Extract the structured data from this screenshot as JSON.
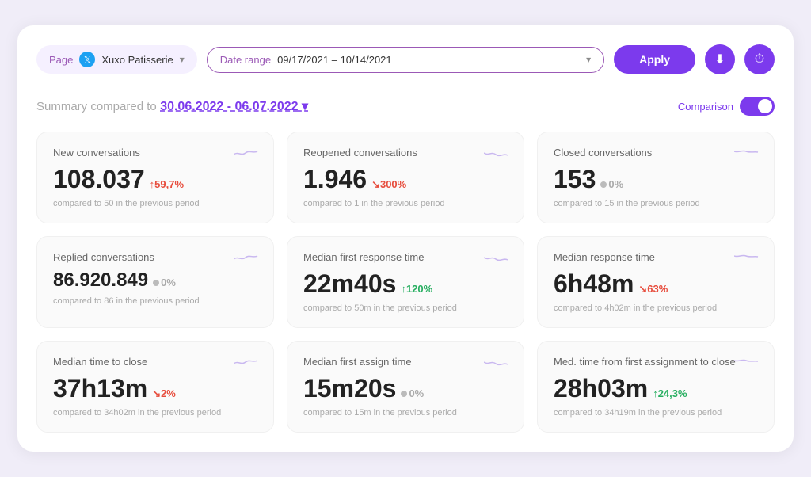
{
  "toolbar": {
    "page_label": "Page",
    "page_name": "Xuxo Patisserie",
    "date_range_label": "Date range",
    "date_value": "09/17/2021 – 10/14/2021",
    "apply_label": "Apply",
    "download_icon": "⬇",
    "clock_icon": "🕐"
  },
  "summary": {
    "title": "Summary compared to",
    "date_range": "30.06.2022 - 06.07.2022",
    "comparison_label": "Comparison"
  },
  "cards": [
    {
      "title": "New conversations",
      "value": "108.037",
      "badge_value": "↑59,7%",
      "badge_type": "up-red",
      "sub": "compared to 50 in the previous period"
    },
    {
      "title": "Reopened conversations",
      "value": "1.946",
      "badge_value": "↘300%",
      "badge_type": "down-red",
      "sub": "compared to 1 in the previous period"
    },
    {
      "title": "Closed conversations",
      "value": "153",
      "badge_value": "0%",
      "badge_type": "neutral",
      "sub": "compared to 15 in the previous period"
    },
    {
      "title": "Replied conversations",
      "value": "86.920.849",
      "badge_value": "0%",
      "badge_type": "neutral",
      "sub": "compared to 86 in the previous period"
    },
    {
      "title": "Median first response time",
      "value": "22m40s",
      "badge_value": "↑120%",
      "badge_type": "up-green",
      "sub": "compared to 50m in the previous period"
    },
    {
      "title": "Median response time",
      "value": "6h48m",
      "badge_value": "↘63%",
      "badge_type": "down-red",
      "sub": "compared to 4h02m in the previous period"
    },
    {
      "title": "Median time to close",
      "value": "37h13m",
      "badge_value": "↘2%",
      "badge_type": "down-red",
      "sub": "compared to 34h02m in the previous period"
    },
    {
      "title": "Median first assign time",
      "value": "15m20s",
      "badge_value": "0%",
      "badge_type": "neutral",
      "sub": "compared to 15m in the previous period"
    },
    {
      "title": "Med. time from first assignment to close",
      "value": "28h03m",
      "badge_value": "↑24,3%",
      "badge_type": "up-green",
      "sub": "compared to 34h19m in the previous period"
    }
  ]
}
